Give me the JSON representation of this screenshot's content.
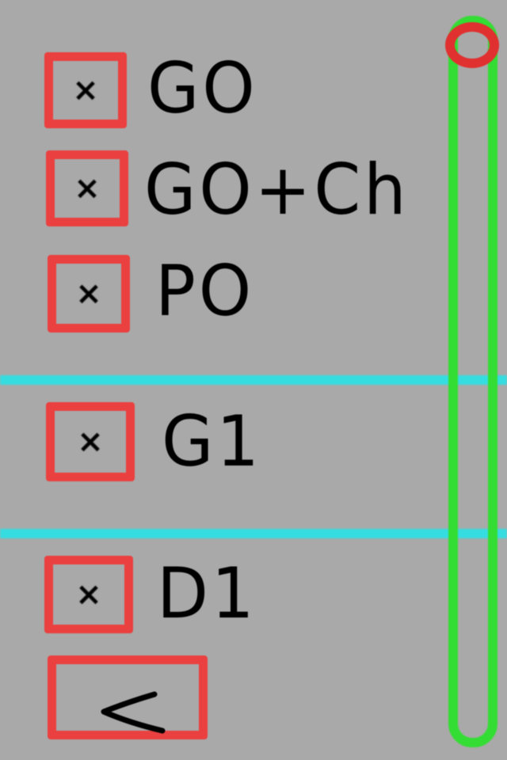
{
  "filters": [
    {
      "id": "go",
      "label": "GO",
      "mark": "×",
      "checked": true
    },
    {
      "id": "go-ch",
      "label": "GO+Ch",
      "mark": "×",
      "checked": true
    },
    {
      "id": "po",
      "label": "PO",
      "mark": "×",
      "checked": true
    },
    {
      "id": "g1",
      "label": "G1",
      "mark": "×",
      "checked": true
    },
    {
      "id": "d1",
      "label": "D1",
      "mark": "×",
      "checked": true
    }
  ],
  "back_button": {
    "icon": "chevron-left-icon"
  },
  "scrollbar": {
    "position": 0.0
  },
  "colors": {
    "background": "#a9a9a9",
    "checkbox_border": "#ea4040",
    "divider": "#35dde0",
    "scrollbar": "#33dd33",
    "scroll_thumb": "#e03030",
    "text": "#000000"
  }
}
